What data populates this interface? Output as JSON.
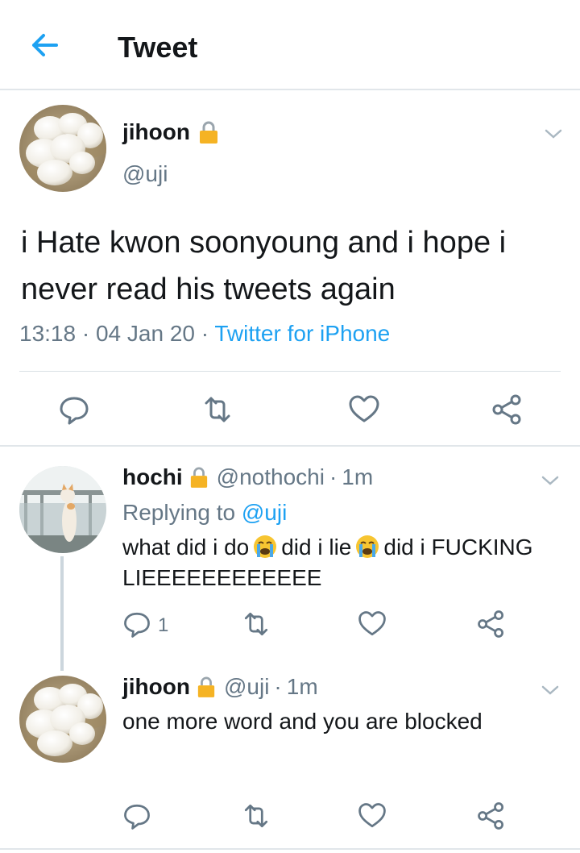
{
  "header": {
    "title": "Tweet"
  },
  "main_tweet": {
    "name": "jihoon",
    "handle": "@uji",
    "text": "i Hate kwon soonyoung and i hope i never read his tweets again",
    "time": "13:18",
    "date": "04 Jan 20",
    "source": "Twitter for iPhone",
    "sep": "·"
  },
  "replies": [
    {
      "name": "hochi",
      "handle": "@nothochi",
      "time": "1m",
      "replying_to_label": "Replying to",
      "replying_to_handle": "@uji",
      "text_part1": "what did i do",
      "text_part2": "did i lie",
      "text_part3": "did i FUCKING LIEEEEEEEEEEEE",
      "reply_count": "1"
    },
    {
      "name": "jihoon",
      "handle": "@uji",
      "time": "1m",
      "text": "one more word and you are blocked"
    }
  ],
  "colors": {
    "accent": "#1da1f2",
    "secondary_text": "#657786",
    "lock": "#f5b324",
    "divider": "#e1e6ea"
  },
  "icons": [
    "back-arrow-icon",
    "lock-icon",
    "chevron-down-icon",
    "reply-icon",
    "retweet-icon",
    "like-icon",
    "share-icon",
    "crying-emoji-icon"
  ]
}
